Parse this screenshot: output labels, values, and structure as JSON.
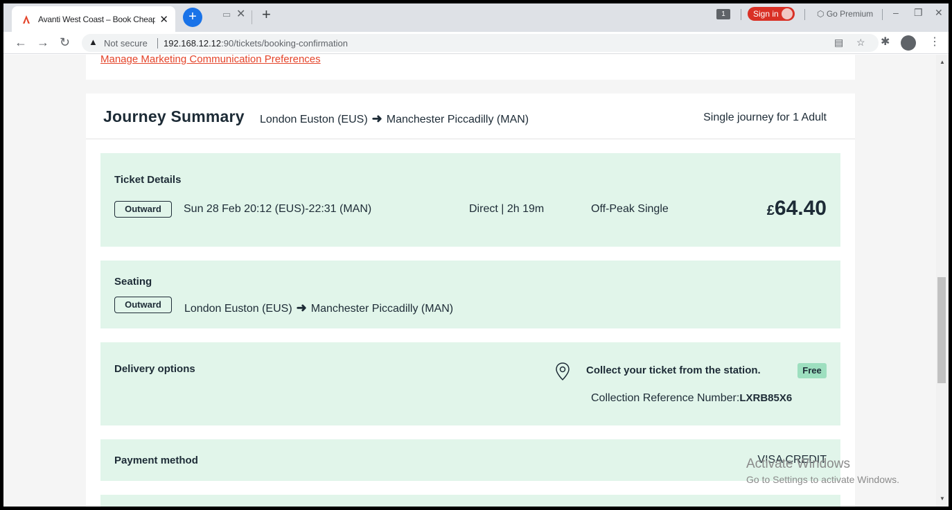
{
  "browser": {
    "tab_title": "Avanti West Coast – Book Cheap",
    "new_tab": "+",
    "badge": "1",
    "sign_in": "Sign in",
    "go_premium": "Go Premium",
    "security": "Not secure",
    "url_host": "192.168.12.12",
    "url_path": ":90/tickets/booking-confirmation"
  },
  "page": {
    "marketing_link": "Manage Marketing Communication Preferences",
    "journey": {
      "title": "Journey Summary",
      "from": "London Euston (EUS)",
      "to": "Manchester Piccadilly (MAN)",
      "passengers": "Single journey for 1 Adult"
    },
    "ticket": {
      "heading": "Ticket Details",
      "direction": "Outward",
      "datetime": "Sun 28 Feb 20:12 (EUS)-22:31 (MAN)",
      "duration": "Direct | 2h 19m",
      "fare": "Off-Peak Single",
      "currency": "£",
      "price": "64.40"
    },
    "seating": {
      "heading": "Seating",
      "direction": "Outward",
      "from": "London Euston (EUS)",
      "to": "Manchester Piccadilly (MAN)"
    },
    "delivery": {
      "heading": "Delivery options",
      "method": "Collect your ticket from the station.",
      "badge": "Free",
      "ref_label": "Collection Reference Number:",
      "ref_value": "LXRB85X6"
    },
    "payment": {
      "heading": "Payment method",
      "value": "VISA CREDIT"
    }
  },
  "watermark": {
    "line1": "Activate Windows",
    "line2": "Go to Settings to activate Windows."
  }
}
